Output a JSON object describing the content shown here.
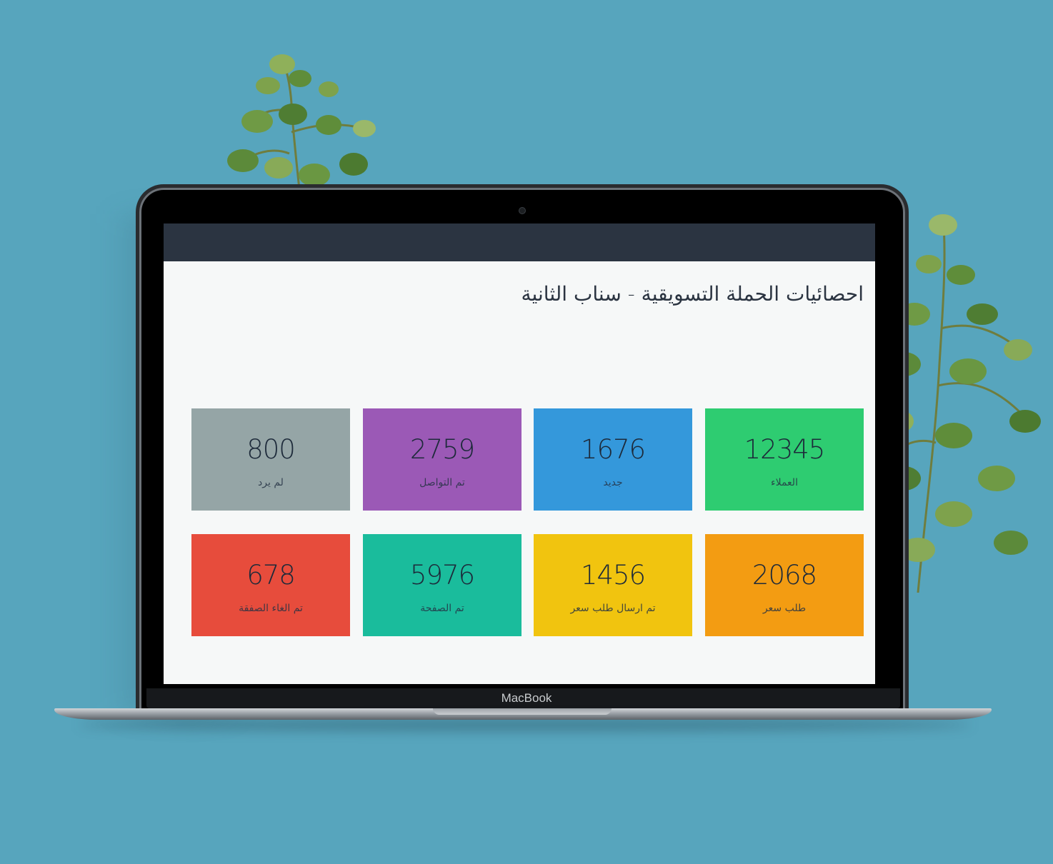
{
  "page": {
    "title": "احصائيات الحملة التسويقية - سناب الثانية"
  },
  "device": {
    "brand": "MacBook"
  },
  "stats": [
    {
      "value": "12345",
      "label": "العملاء",
      "color": "#2ecc71"
    },
    {
      "value": "1676",
      "label": "جديد",
      "color": "#3498db"
    },
    {
      "value": "2759",
      "label": "تم التواصل",
      "color": "#9b59b6"
    },
    {
      "value": "800",
      "label": "لم يرد",
      "color": "#95a5a6"
    },
    {
      "value": "2068",
      "label": "طلب سعر",
      "color": "#f39c12"
    },
    {
      "value": "1456",
      "label": "تم ارسال طلب سعر",
      "color": "#f1c40f"
    },
    {
      "value": "5976",
      "label": "تم الصفحة",
      "color": "#1abc9c"
    },
    {
      "value": "678",
      "label": "تم الغاء الصفقة",
      "color": "#e74c3c"
    }
  ],
  "colors": {
    "background": "#57a5bd",
    "topbar": "#2b3441",
    "screen": "#f6f8f8"
  }
}
